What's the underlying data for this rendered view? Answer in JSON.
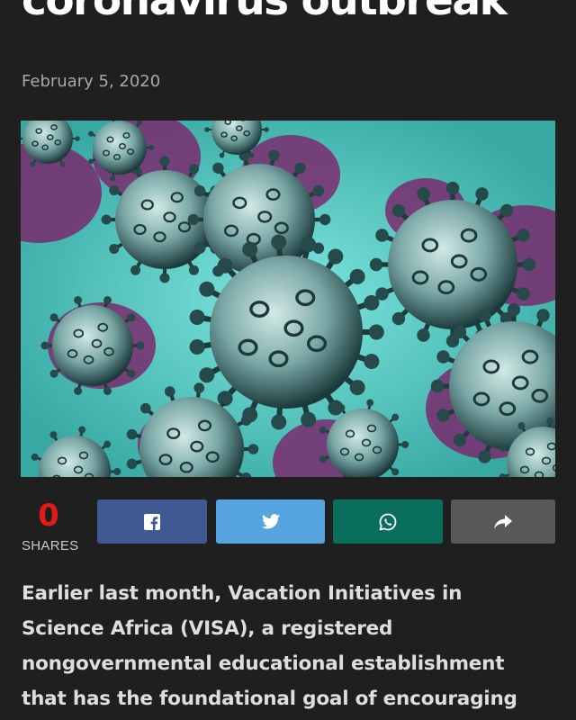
{
  "article": {
    "headline_visible_line": "coronavirus outbreak",
    "date": "February 5, 2020",
    "hero_image": "coronavirus-illustration"
  },
  "share": {
    "count": "0",
    "label": "SHARES",
    "buttons": [
      {
        "name": "facebook",
        "icon": "facebook-icon",
        "color": "#3f5a92"
      },
      {
        "name": "twitter",
        "icon": "twitter-icon",
        "color": "#55a4e0"
      },
      {
        "name": "whatsapp",
        "icon": "whatsapp-icon",
        "color": "#0a6e5d"
      },
      {
        "name": "more",
        "icon": "share-arrow-icon",
        "color": "#585858"
      }
    ]
  },
  "body": {
    "paragraph": "Earlier last month, Vacation Initiatives in\nScience Africa (VISA),  a registered\nnongovernmental educational establishment\nthat has the foundational goal of encouraging"
  },
  "colors": {
    "background": "#1f1f1f",
    "shares_count": "#e21a1a",
    "date_text": "#a8a8a8"
  }
}
